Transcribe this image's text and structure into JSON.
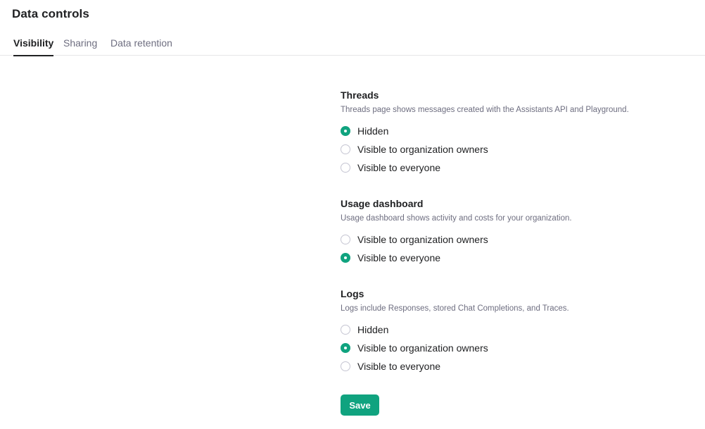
{
  "page": {
    "title": "Data controls"
  },
  "tabs": [
    {
      "label": "Visibility",
      "active": true
    },
    {
      "label": "Sharing",
      "active": false
    },
    {
      "label": "Data retention",
      "active": false
    }
  ],
  "sections": {
    "threads": {
      "title": "Threads",
      "description": "Threads page shows messages created with the Assistants API and Playground.",
      "options": [
        {
          "label": "Hidden",
          "checked": true
        },
        {
          "label": "Visible to organization owners",
          "checked": false
        },
        {
          "label": "Visible to everyone",
          "checked": false
        }
      ]
    },
    "usage": {
      "title": "Usage dashboard",
      "description": "Usage dashboard shows activity and costs for your organization.",
      "options": [
        {
          "label": "Visible to organization owners",
          "checked": false
        },
        {
          "label": "Visible to everyone",
          "checked": true
        }
      ]
    },
    "logs": {
      "title": "Logs",
      "description": "Logs include Responses, stored Chat Completions, and Traces.",
      "options": [
        {
          "label": "Hidden",
          "checked": false
        },
        {
          "label": "Visible to organization owners",
          "checked": true
        },
        {
          "label": "Visible to everyone",
          "checked": false
        }
      ]
    }
  },
  "actions": {
    "save_label": "Save"
  },
  "colors": {
    "accent": "#10a37f",
    "text": "#202123",
    "muted": "#6e6e80",
    "border": "#e6e6e8"
  }
}
